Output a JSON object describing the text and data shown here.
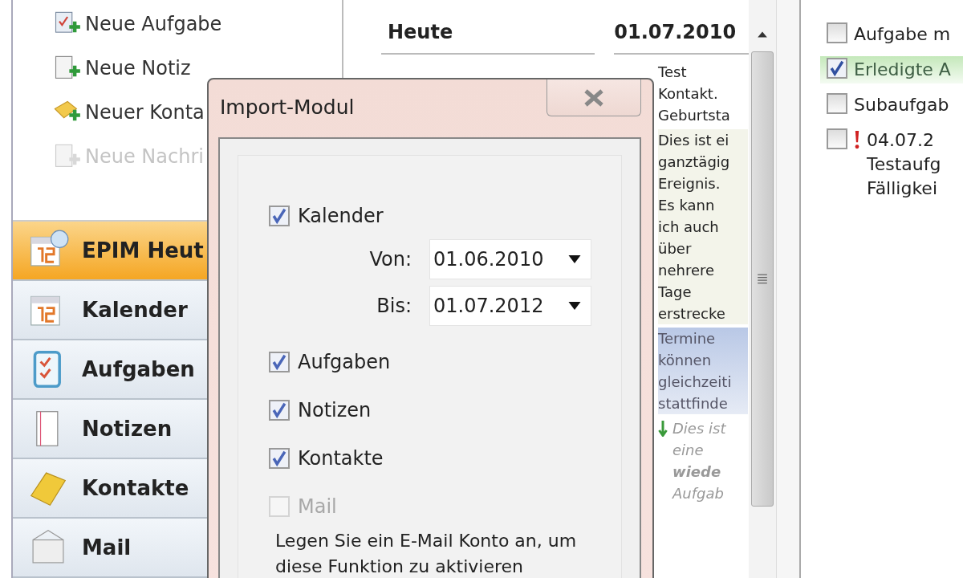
{
  "sidebar": {
    "actions": [
      {
        "kind": "task",
        "label": "Neue Aufgabe",
        "disabled": false
      },
      {
        "kind": "note",
        "label": "Neue Notiz",
        "disabled": false
      },
      {
        "kind": "contact",
        "label": "Neuer Konta",
        "disabled": false
      },
      {
        "kind": "message",
        "label": "Neue Nachri",
        "disabled": true
      }
    ],
    "nav": [
      {
        "kind": "today",
        "label": "EPIM Heut",
        "selected": true
      },
      {
        "kind": "calendar",
        "label": "Kalender",
        "selected": false
      },
      {
        "kind": "tasks",
        "label": "Aufgaben",
        "selected": false
      },
      {
        "kind": "notes",
        "label": "Notizen",
        "selected": false
      },
      {
        "kind": "contacts",
        "label": "Kontakte",
        "selected": false
      },
      {
        "kind": "mail",
        "label": "Mail",
        "selected": false
      }
    ]
  },
  "today": {
    "heading": "Heute",
    "date": "01.07.2010",
    "entries": [
      {
        "kind": "birthday",
        "lines": [
          "Test",
          "Kontakt.",
          "Geburtsta"
        ]
      },
      {
        "kind": "allday",
        "lines": [
          "Dies ist ei",
          "ganztägig",
          "Ereignis.",
          "Es kann",
          "ich auch",
          "über",
          "nehrere",
          "Tage",
          "erstrecke"
        ]
      },
      {
        "kind": "appointment",
        "lines": [
          "Termine",
          "können",
          "gleichzeiti",
          "stattfinde"
        ]
      },
      {
        "kind": "recurring",
        "lines": [
          "Dies ist",
          "eine",
          "wiede",
          "Aufgab"
        ]
      }
    ]
  },
  "tasks": [
    {
      "lines": [
        "Aufgabe m"
      ],
      "checked": false,
      "important": false
    },
    {
      "lines": [
        "Erledigte A"
      ],
      "checked": true,
      "important": false
    },
    {
      "lines": [
        "Subaufgab"
      ],
      "checked": false,
      "important": false
    },
    {
      "lines": [
        "04.07.2",
        "Testaufg",
        "Fälligkei"
      ],
      "checked": false,
      "important": true
    }
  ],
  "dialog": {
    "title": "Import-Modul",
    "options": [
      {
        "kind": "checkbox",
        "label": "Kalender",
        "checked": true,
        "disabled": false
      },
      {
        "kind": "date",
        "label": "Von:",
        "value": "01.06.2010"
      },
      {
        "kind": "date",
        "label": "Bis:",
        "value": "01.07.2012"
      },
      {
        "kind": "checkbox",
        "label": "Aufgaben",
        "checked": true,
        "disabled": false
      },
      {
        "kind": "checkbox",
        "label": "Notizen",
        "checked": true,
        "disabled": false
      },
      {
        "kind": "checkbox",
        "label": "Kontakte",
        "checked": true,
        "disabled": false
      },
      {
        "kind": "checkbox",
        "label": "Mail",
        "checked": false,
        "disabled": true
      },
      {
        "kind": "note",
        "text": "Legen Sie ein E-Mail Konto an, um diese Funktion zu aktivieren"
      }
    ]
  }
}
